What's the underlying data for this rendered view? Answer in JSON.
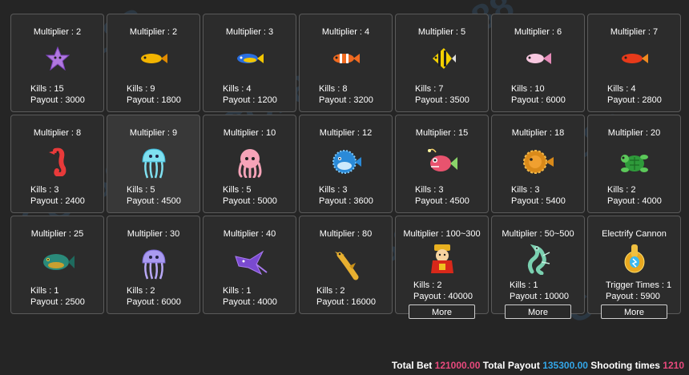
{
  "cards": [
    {
      "title": "Multiplier : 2",
      "icon": "starfish-icon",
      "stat1": "Kills : 15",
      "stat2": "Payout : 3000"
    },
    {
      "title": "Multiplier : 2",
      "icon": "yellow-fish-icon",
      "stat1": "Kills : 9",
      "stat2": "Payout : 1800"
    },
    {
      "title": "Multiplier : 3",
      "icon": "blue-fish-icon",
      "stat1": "Kills : 4",
      "stat2": "Payout : 1200"
    },
    {
      "title": "Multiplier : 4",
      "icon": "clownfish-icon",
      "stat1": "Kills : 8",
      "stat2": "Payout : 3200"
    },
    {
      "title": "Multiplier : 5",
      "icon": "angelfish-icon",
      "stat1": "Kills : 7",
      "stat2": "Payout : 3500"
    },
    {
      "title": "Multiplier : 6",
      "icon": "pink-fish-icon",
      "stat1": "Kills : 10",
      "stat2": "Payout : 6000"
    },
    {
      "title": "Multiplier : 7",
      "icon": "red-fish-icon",
      "stat1": "Kills : 4",
      "stat2": "Payout : 2800"
    },
    {
      "title": "Multiplier : 8",
      "icon": "seahorse-icon",
      "stat1": "Kills : 3",
      "stat2": "Payout : 2400"
    },
    {
      "title": "Multiplier : 9",
      "icon": "jellyfish-icon",
      "stat1": "Kills : 5",
      "stat2": "Payout : 4500"
    },
    {
      "title": "Multiplier : 10",
      "icon": "octopus-icon",
      "stat1": "Kills : 5",
      "stat2": "Payout : 5000"
    },
    {
      "title": "Multiplier : 12",
      "icon": "pufferfish-icon",
      "stat1": "Kills : 3",
      "stat2": "Payout : 3600"
    },
    {
      "title": "Multiplier : 15",
      "icon": "anglerfish-icon",
      "stat1": "Kills : 3",
      "stat2": "Payout : 4500"
    },
    {
      "title": "Multiplier : 18",
      "icon": "lionfish-icon",
      "stat1": "Kills : 3",
      "stat2": "Payout : 5400"
    },
    {
      "title": "Multiplier : 20",
      "icon": "turtle-icon",
      "stat1": "Kills : 2",
      "stat2": "Payout : 4000"
    },
    {
      "title": "Multiplier : 25",
      "icon": "grouper-icon",
      "stat1": "Kills : 1",
      "stat2": "Payout : 2500"
    },
    {
      "title": "Multiplier : 30",
      "icon": "purple-jellyfish-icon",
      "stat1": "Kills : 2",
      "stat2": "Payout : 6000"
    },
    {
      "title": "Multiplier : 40",
      "icon": "manta-ray-icon",
      "stat1": "Kills : 1",
      "stat2": "Payout : 4000"
    },
    {
      "title": "Multiplier : 80",
      "icon": "hammerhead-shark-icon",
      "stat1": "Kills : 2",
      "stat2": "Payout : 16000"
    },
    {
      "title": "Multiplier : 100~300",
      "icon": "fortune-god-icon",
      "stat1": "Kills : 2",
      "stat2": "Payout : 40000",
      "more": "More"
    },
    {
      "title": "Multiplier : 50~500",
      "icon": "dragon-icon",
      "stat1": "Kills : 1",
      "stat2": "Payout : 10000",
      "more": "More"
    },
    {
      "title": "Electrify Cannon",
      "icon": "electric-cannon-icon",
      "stat1": "Trigger Times : 1",
      "stat2": "Payout : 5900",
      "more": "More"
    }
  ],
  "footer": {
    "total_bet_label": "Total Bet",
    "total_bet_value": "121000.00",
    "total_payout_label": "Total Payout",
    "total_payout_value": "135300.00",
    "shooting_label": "Shooting times",
    "shooting_value": "1210"
  },
  "watermark": "CO188",
  "colors": {
    "background": "#252525",
    "card_border": "#5a5a5a",
    "bet_value": "#e8497d",
    "payout_value": "#33a6e8"
  }
}
